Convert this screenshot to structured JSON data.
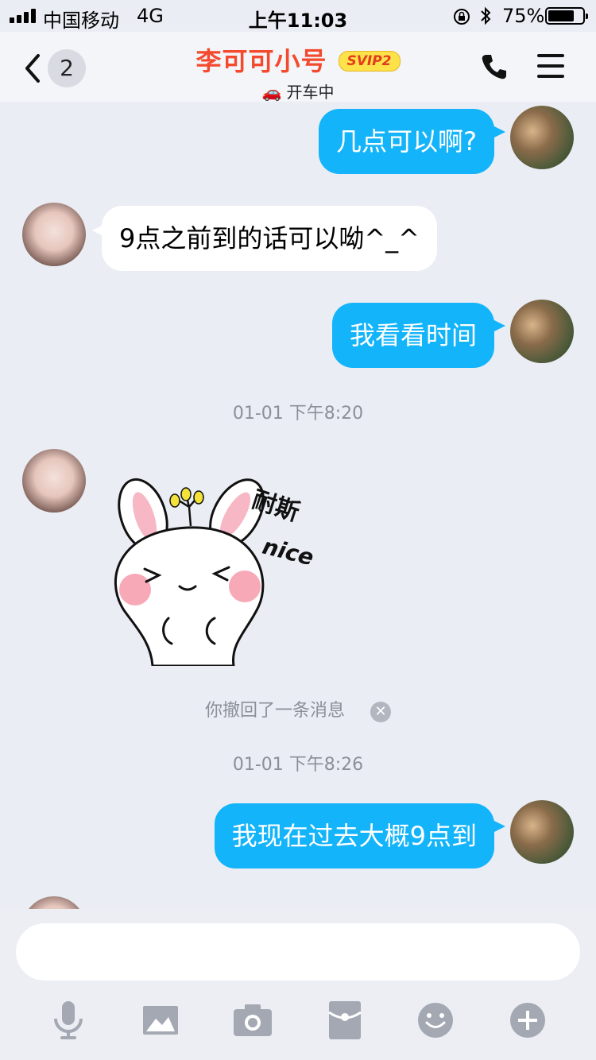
{
  "status_bar": {
    "carrier": "中国移动",
    "network": "4G",
    "time": "上午11:03",
    "battery_percent": "75%",
    "battery_level": 0.75
  },
  "nav": {
    "unread_count": "2",
    "contact_name": "李可可小号",
    "vip_badge": "SVIP2",
    "status_text": "开车中",
    "status_icon": "car-icon",
    "accent_color": "#f34a2e"
  },
  "messages": [
    {
      "side": "out",
      "text": "几点可以啊?"
    },
    {
      "side": "in",
      "text": "9点之前到的话可以呦^_^"
    },
    {
      "side": "out",
      "text": "我看看时间"
    }
  ],
  "timestamp_1": "01-01 下午8:20",
  "sticker": {
    "caption_1": "耐斯",
    "caption_2": "nice"
  },
  "recall_notice": "你撤回了一条消息",
  "timestamp_2": "01-01 下午8:26",
  "message_4": {
    "side": "out",
    "text": "我现在过去大概9点到"
  },
  "input": {
    "placeholder": "",
    "value": ""
  },
  "toolbar": [
    {
      "name": "voice-button",
      "icon": "microphone-icon"
    },
    {
      "name": "image-button",
      "icon": "image-icon"
    },
    {
      "name": "camera-button",
      "icon": "camera-icon"
    },
    {
      "name": "red-packet-button",
      "icon": "red-packet-icon"
    },
    {
      "name": "emoji-button",
      "icon": "emoji-icon"
    },
    {
      "name": "more-button",
      "icon": "plus-icon"
    }
  ],
  "colors": {
    "outgoing_bubble": "#14b4fa",
    "incoming_bubble": "#ffffff",
    "background": "#eaedf4",
    "icon_gray": "#a3a8b3"
  }
}
